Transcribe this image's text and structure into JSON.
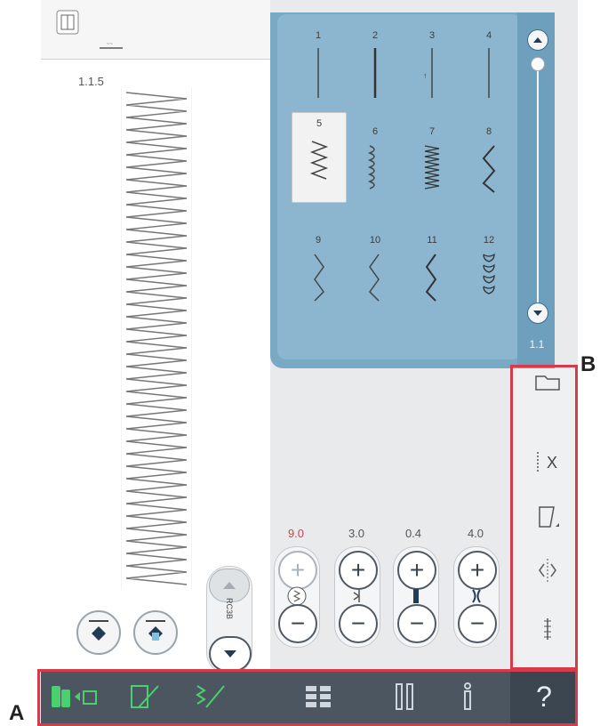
{
  "preview": {
    "stitch_number": "1.1.5"
  },
  "stitch_menu": {
    "cells": [
      {
        "num": "1",
        "sel": false
      },
      {
        "num": "2",
        "sel": false
      },
      {
        "num": "3",
        "sel": false
      },
      {
        "num": "4",
        "sel": false
      },
      {
        "num": "5",
        "sel": true
      },
      {
        "num": "6",
        "sel": false
      },
      {
        "num": "7",
        "sel": false
      },
      {
        "num": "8",
        "sel": false
      },
      {
        "num": "9",
        "sel": false
      },
      {
        "num": "10",
        "sel": false
      },
      {
        "num": "11",
        "sel": false
      },
      {
        "num": "12",
        "sel": false
      }
    ],
    "page_label": "1.1"
  },
  "params": {
    "p1": "9.0",
    "p2": "3.0",
    "p3": "0.4",
    "p4": "4.0"
  },
  "params_colors": {
    "p1": "#d0404a",
    "other": "#555555"
  },
  "stitch_length_label": "RC3B",
  "help_icon": "?",
  "callouts": {
    "a": "A",
    "b": "B"
  },
  "colors": {
    "menu_blue": "#7aa9c6",
    "accent_green": "#4ad06e",
    "frame_red": "#d73b4b",
    "bar": "#4c5660"
  }
}
